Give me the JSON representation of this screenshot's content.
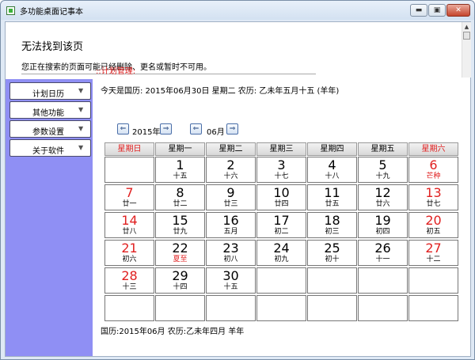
{
  "window": {
    "title": "多功能桌面记事本",
    "min_label": "▬",
    "max_label": "▣",
    "close_label": "✕"
  },
  "error": {
    "title": "无法找到该页",
    "message": "您正在搜索的页面可能已经删除、更名或暂时不可用。"
  },
  "sidebar": {
    "items": [
      {
        "label": "计划日历"
      },
      {
        "label": "其他功能"
      },
      {
        "label": "参数设置"
      },
      {
        "label": "关于软件"
      }
    ]
  },
  "plan": {
    "label": "::计划管理:",
    "today": "今天是国历: 2015年06月30日  星期二  农历: 乙未年五月十五 (羊年)"
  },
  "nav": {
    "year": "2015年",
    "month": "06月",
    "prev": "⇐",
    "next": "⇒"
  },
  "calendar": {
    "weekdays": [
      "星期日",
      "星期一",
      "星期二",
      "星期三",
      "星期四",
      "星期五",
      "星期六"
    ],
    "rows": [
      [
        {
          "d": "",
          "l": ""
        },
        {
          "d": "1",
          "l": "十五"
        },
        {
          "d": "2",
          "l": "十六"
        },
        {
          "d": "3",
          "l": "十七"
        },
        {
          "d": "4",
          "l": "十八"
        },
        {
          "d": "5",
          "l": "十九"
        },
        {
          "d": "6",
          "l": "芒种",
          "lr": true
        }
      ],
      [
        {
          "d": "7",
          "l": "廿一"
        },
        {
          "d": "8",
          "l": "廿二"
        },
        {
          "d": "9",
          "l": "廿三"
        },
        {
          "d": "10",
          "l": "廿四"
        },
        {
          "d": "11",
          "l": "廿五"
        },
        {
          "d": "12",
          "l": "廿六"
        },
        {
          "d": "13",
          "l": "廿七"
        }
      ],
      [
        {
          "d": "14",
          "l": "廿八"
        },
        {
          "d": "15",
          "l": "廿九"
        },
        {
          "d": "16",
          "l": "五月"
        },
        {
          "d": "17",
          "l": "初二"
        },
        {
          "d": "18",
          "l": "初三"
        },
        {
          "d": "19",
          "l": "初四"
        },
        {
          "d": "20",
          "l": "初五"
        }
      ],
      [
        {
          "d": "21",
          "l": "初六"
        },
        {
          "d": "22",
          "l": "夏至",
          "lr": true
        },
        {
          "d": "23",
          "l": "初八"
        },
        {
          "d": "24",
          "l": "初九"
        },
        {
          "d": "25",
          "l": "初十"
        },
        {
          "d": "26",
          "l": "十一"
        },
        {
          "d": "27",
          "l": "十二"
        }
      ],
      [
        {
          "d": "28",
          "l": "十三"
        },
        {
          "d": "29",
          "l": "十四"
        },
        {
          "d": "30",
          "l": "十五"
        },
        {
          "d": "",
          "l": ""
        },
        {
          "d": "",
          "l": ""
        },
        {
          "d": "",
          "l": ""
        },
        {
          "d": "",
          "l": ""
        }
      ],
      [
        {
          "d": "",
          "l": ""
        },
        {
          "d": "",
          "l": ""
        },
        {
          "d": "",
          "l": ""
        },
        {
          "d": "",
          "l": ""
        },
        {
          "d": "",
          "l": ""
        },
        {
          "d": "",
          "l": ""
        },
        {
          "d": "",
          "l": ""
        }
      ]
    ]
  },
  "footer": {
    "text": "国历:2015年06月  农历:乙未年四月  羊年"
  },
  "colors": {
    "sidebar": "#8f8ff4",
    "accent_red": "#e02020"
  }
}
